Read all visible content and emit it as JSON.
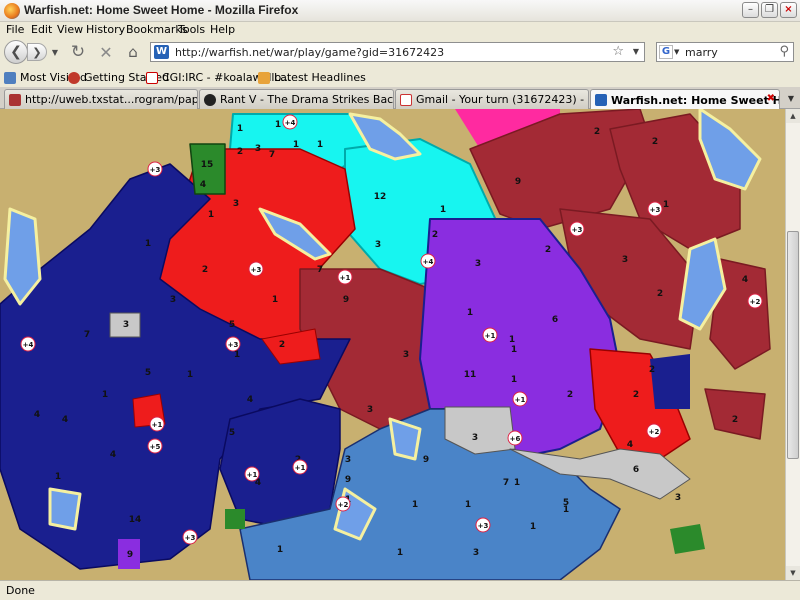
{
  "window": {
    "title": "Warfish.net: Home Sweet Home - Mozilla Firefox"
  },
  "menu": [
    "File",
    "Edit",
    "View",
    "History",
    "Bookmarks",
    "Tools",
    "Help"
  ],
  "nav": {
    "url": "http://warfish.net/war/play/game?gid=31672423",
    "search_query": "marry",
    "search_engine_icon": "G"
  },
  "bookmarks": [
    {
      "label": "Most Visited",
      "icon": "gear-icon"
    },
    {
      "label": "Getting Started",
      "icon": "firefox-icon"
    },
    {
      "label": "CGI:IRC - #koalawallo...",
      "icon": "cgi-icon"
    },
    {
      "label": "Latest Headlines",
      "icon": "rss-icon"
    }
  ],
  "tabs": [
    {
      "label": "http://uweb.txstat...rogram/papers.htm",
      "active": false
    },
    {
      "label": "Rant V - The Drama Strikes Back - Page...",
      "active": false
    },
    {
      "label": "Gmail - Your turn (31672423) - philrigne...",
      "active": false
    },
    {
      "label": "Warfish.net: Home Sweet Home",
      "active": true
    }
  ],
  "status": "Done",
  "map": {
    "colors": {
      "background": "#c8b070",
      "navy": "#1a1f8f",
      "red": "#ee1c1c",
      "maroon": "#a32a35",
      "cyan": "#17f5f0",
      "purple": "#8a2de0",
      "steel": "#4a84c8",
      "gray": "#c8c8c8",
      "green": "#2b8a2b",
      "magenta": "#ff2aa0",
      "water": "#6f9fe8"
    },
    "armies": [
      "1",
      "1",
      "2",
      "15",
      "4",
      "3",
      "1",
      "7",
      "1",
      "9",
      "2",
      "2",
      "12",
      "2",
      "1",
      "3",
      "3",
      "1",
      "3",
      "2",
      "7",
      "2",
      "3",
      "1",
      "1",
      "3",
      "1",
      "2",
      "9",
      "5",
      "1",
      "2",
      "1",
      "3",
      "4",
      "6",
      "2",
      "11",
      "1",
      "1",
      "3",
      "4",
      "4",
      "7",
      "5",
      "1",
      "4",
      "5",
      "1",
      "1",
      "2",
      "2",
      "2",
      "3",
      "1",
      "4",
      "4",
      "3",
      "9",
      "3",
      "4",
      "6",
      "3",
      "1",
      "7",
      "1",
      "1",
      "5",
      "14",
      "9",
      "9",
      "1",
      "1",
      "1",
      "1",
      "1",
      "3",
      "2"
    ],
    "bonuses": [
      "+4",
      "+3",
      "+3",
      "+3",
      "+3",
      "+4",
      "+1",
      "+4",
      "+3",
      "+1",
      "+1",
      "+2",
      "+1",
      "+6",
      "+2",
      "+5",
      "+1",
      "+1",
      "+2",
      "+3",
      "+3",
      "+1"
    ]
  }
}
